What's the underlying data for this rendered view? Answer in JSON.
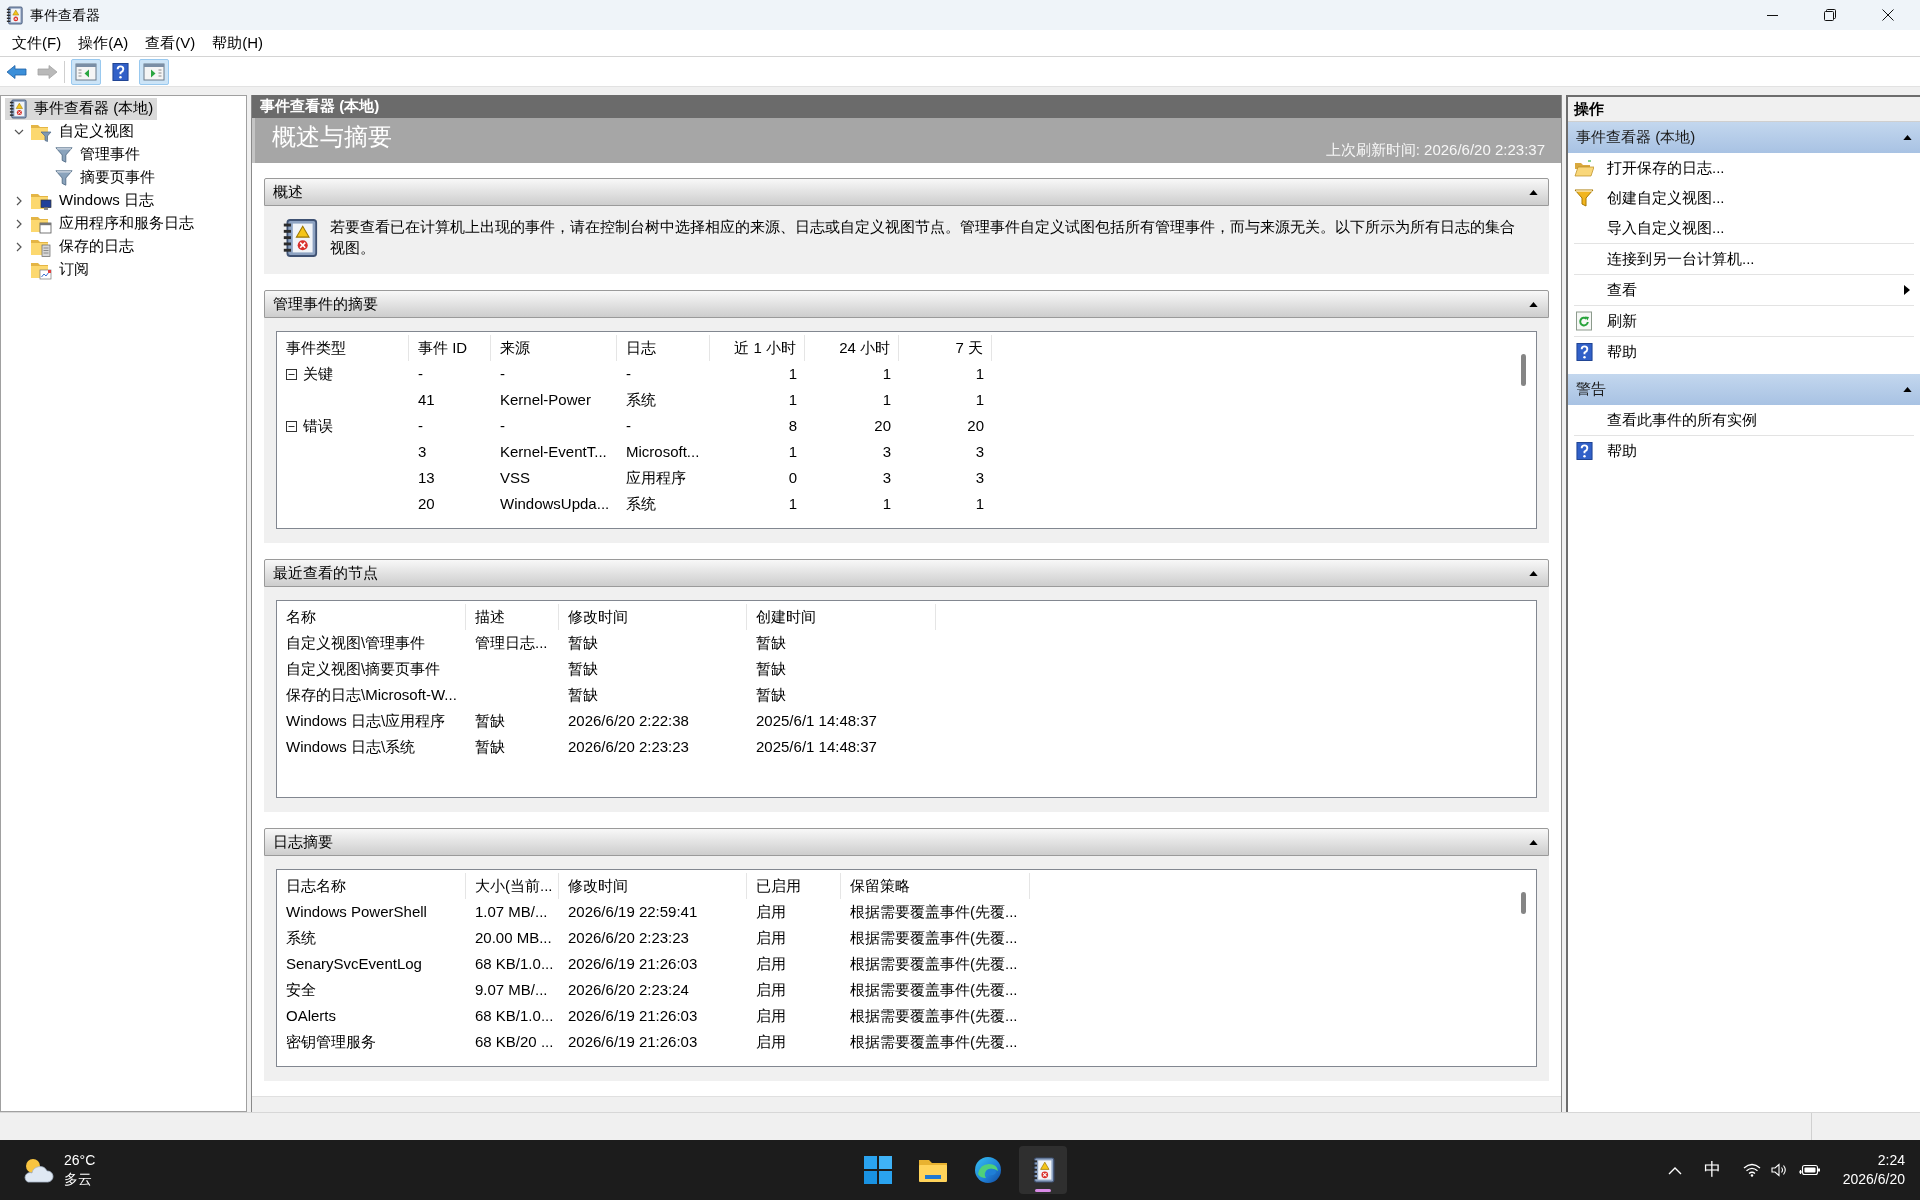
{
  "window": {
    "title": "事件查看器"
  },
  "menu": [
    "文件(F)",
    "操作(A)",
    "查看(V)",
    "帮助(H)"
  ],
  "toolbar": [
    {
      "kind": "back",
      "disabled": false,
      "pressed": false
    },
    {
      "kind": "forward",
      "disabled": true,
      "pressed": false
    },
    {
      "kind": "console_tree",
      "disabled": false,
      "pressed": true
    },
    {
      "kind": "help",
      "disabled": false,
      "pressed": false
    },
    {
      "kind": "action_pane",
      "disabled": false,
      "pressed": true
    }
  ],
  "tree": [
    {
      "label": "事件查看器 (本地)",
      "kind": "viewer",
      "selected": true,
      "children": [
        {
          "label": "自定义视图",
          "kind": "views_folder",
          "selected": false,
          "expanded": true,
          "children": [
            {
              "label": "管理事件",
              "kind": "filter",
              "selected": false
            },
            {
              "label": "摘要页事件",
              "kind": "filter",
              "selected": false
            }
          ]
        },
        {
          "label": "Windows 日志",
          "kind": "logs_folder",
          "selected": false,
          "expanded": false
        },
        {
          "label": "应用程序和服务日志",
          "kind": "apps_folder",
          "selected": false,
          "expanded": false
        },
        {
          "label": "保存的日志",
          "kind": "saved_folder",
          "selected": false,
          "expanded": false
        },
        {
          "label": "订阅",
          "kind": "subscriptions_folder",
          "selected": false
        }
      ]
    }
  ],
  "main": {
    "header": "事件查看器 (本地)",
    "title": "概述与摘要",
    "refreshed": "上次刷新时间: 2026/6/20 2:23:37",
    "sections": [
      {
        "kind": "overview",
        "title": "概述",
        "expanded": true,
        "text": "若要查看已在计算机上出现的事件，请在控制台树中选择相应的来源、日志或自定义视图节点。管理事件自定义试图包括所有管理事件，而与来源无关。以下所示为所有日志的集合视图。"
      },
      {
        "kind": "event_summary",
        "title": "管理事件的摘要",
        "expanded": true,
        "columns": [
          "事件类型",
          "事件 ID",
          "来源",
          "日志",
          "近 1 小时",
          "24 小时",
          "7 天"
        ],
        "rows": [
          {
            "type": "关键",
            "expanded": true,
            "event_id": "-",
            "source": "-",
            "log": "-",
            "last_hour": "1",
            "last_24h": "1",
            "last_7d": "1",
            "children": [
              {
                "event_id": "41",
                "source": "Kernel-Power",
                "log": "系统",
                "last_hour": "1",
                "last_24h": "1",
                "last_7d": "1"
              }
            ]
          },
          {
            "type": "错误",
            "expanded": true,
            "event_id": "-",
            "source": "-",
            "log": "-",
            "last_hour": "8",
            "last_24h": "20",
            "last_7d": "20",
            "children": [
              {
                "event_id": "3",
                "source": "Kernel-EventT...",
                "log": "Microsoft...",
                "last_hour": "1",
                "last_24h": "3",
                "last_7d": "3"
              },
              {
                "event_id": "13",
                "source": "VSS",
                "log": "应用程序",
                "last_hour": "0",
                "last_24h": "3",
                "last_7d": "3"
              },
              {
                "event_id": "20",
                "source": "WindowsUpda...",
                "log": "系统",
                "last_hour": "1",
                "last_24h": "1",
                "last_7d": "1"
              }
            ]
          }
        ]
      },
      {
        "kind": "recent_nodes",
        "title": "最近查看的节点",
        "expanded": true,
        "columns": [
          "名称",
          "描述",
          "修改时间",
          "创建时间"
        ],
        "rows": [
          {
            "name": "自定义视图\\管理事件",
            "description": "管理日志...",
            "modified": "暂缺",
            "created": "暂缺"
          },
          {
            "name": "自定义视图\\摘要页事件",
            "modified": "暂缺",
            "created": "暂缺"
          },
          {
            "name": "保存的日志\\Microsoft-W...",
            "modified": "暂缺",
            "created": "暂缺"
          },
          {
            "name": "Windows 日志\\应用程序",
            "description": "暂缺",
            "modified": "2026/6/20 2:22:38",
            "created": "2025/6/1 14:48:37"
          },
          {
            "name": "Windows 日志\\系统",
            "description": "暂缺",
            "modified": "2026/6/20 2:23:23",
            "created": "2025/6/1 14:48:37"
          }
        ]
      },
      {
        "kind": "log_summary",
        "title": "日志摘要",
        "expanded": true,
        "columns": [
          "日志名称",
          "大小(当前...",
          "修改时间",
          "已启用",
          "保留策略"
        ],
        "rows": [
          {
            "name": "Windows PowerShell",
            "size": "1.07 MB/...",
            "modified": "2026/6/19 22:59:41",
            "enabled": "启用",
            "retention": "根据需要覆盖事件(先覆..."
          },
          {
            "name": "系统",
            "size": "20.00 MB...",
            "modified": "2026/6/20 2:23:23",
            "enabled": "启用",
            "retention": "根据需要覆盖事件(先覆..."
          },
          {
            "name": "SenarySvcEventLog",
            "size": "68 KB/1.0...",
            "modified": "2026/6/19 21:26:03",
            "enabled": "启用",
            "retention": "根据需要覆盖事件(先覆..."
          },
          {
            "name": "安全",
            "size": "9.07 MB/...",
            "modified": "2026/6/20 2:23:24",
            "enabled": "启用",
            "retention": "根据需要覆盖事件(先覆..."
          },
          {
            "name": "OAlerts",
            "size": "68 KB/1.0...",
            "modified": "2026/6/19 21:26:03",
            "enabled": "启用",
            "retention": "根据需要覆盖事件(先覆..."
          },
          {
            "name": "密钥管理服务",
            "size": "68 KB/20 ...",
            "modified": "2026/6/19 21:26:03",
            "enabled": "启用",
            "retention": "根据需要覆盖事件(先覆..."
          }
        ]
      }
    ]
  },
  "actions": {
    "title": "操作",
    "sections": [
      {
        "title": "事件查看器 (本地)",
        "expanded": true,
        "groups": [
          [
            {
              "label": "打开保存的日志...",
              "kind": "open"
            },
            {
              "label": "创建自定义视图...",
              "kind": "filter"
            },
            {
              "label": "导入自定义视图...",
              "kind": "plain"
            }
          ],
          [
            {
              "label": "连接到另一台计算机...",
              "kind": "plain"
            }
          ],
          [
            {
              "label": "查看",
              "kind": "submenu"
            }
          ],
          [
            {
              "label": "刷新",
              "kind": "refresh"
            }
          ],
          [
            {
              "label": "帮助",
              "kind": "help"
            }
          ]
        ]
      },
      {
        "title": "警告",
        "expanded": true,
        "groups": [
          [
            {
              "label": "查看此事件的所有实例",
              "kind": "plain"
            }
          ],
          [
            {
              "label": "帮助",
              "kind": "help"
            }
          ]
        ]
      }
    ]
  },
  "taskbar": {
    "weather": {
      "temperature": "26°C",
      "condition": "多云"
    },
    "apps": [
      {
        "kind": "start",
        "active": false
      },
      {
        "kind": "explorer",
        "active": false
      },
      {
        "kind": "edge",
        "active": false
      },
      {
        "kind": "event_viewer",
        "active": true
      }
    ],
    "ime": "中",
    "clock": {
      "time": "2:24",
      "date": "2026/6/20"
    }
  }
}
